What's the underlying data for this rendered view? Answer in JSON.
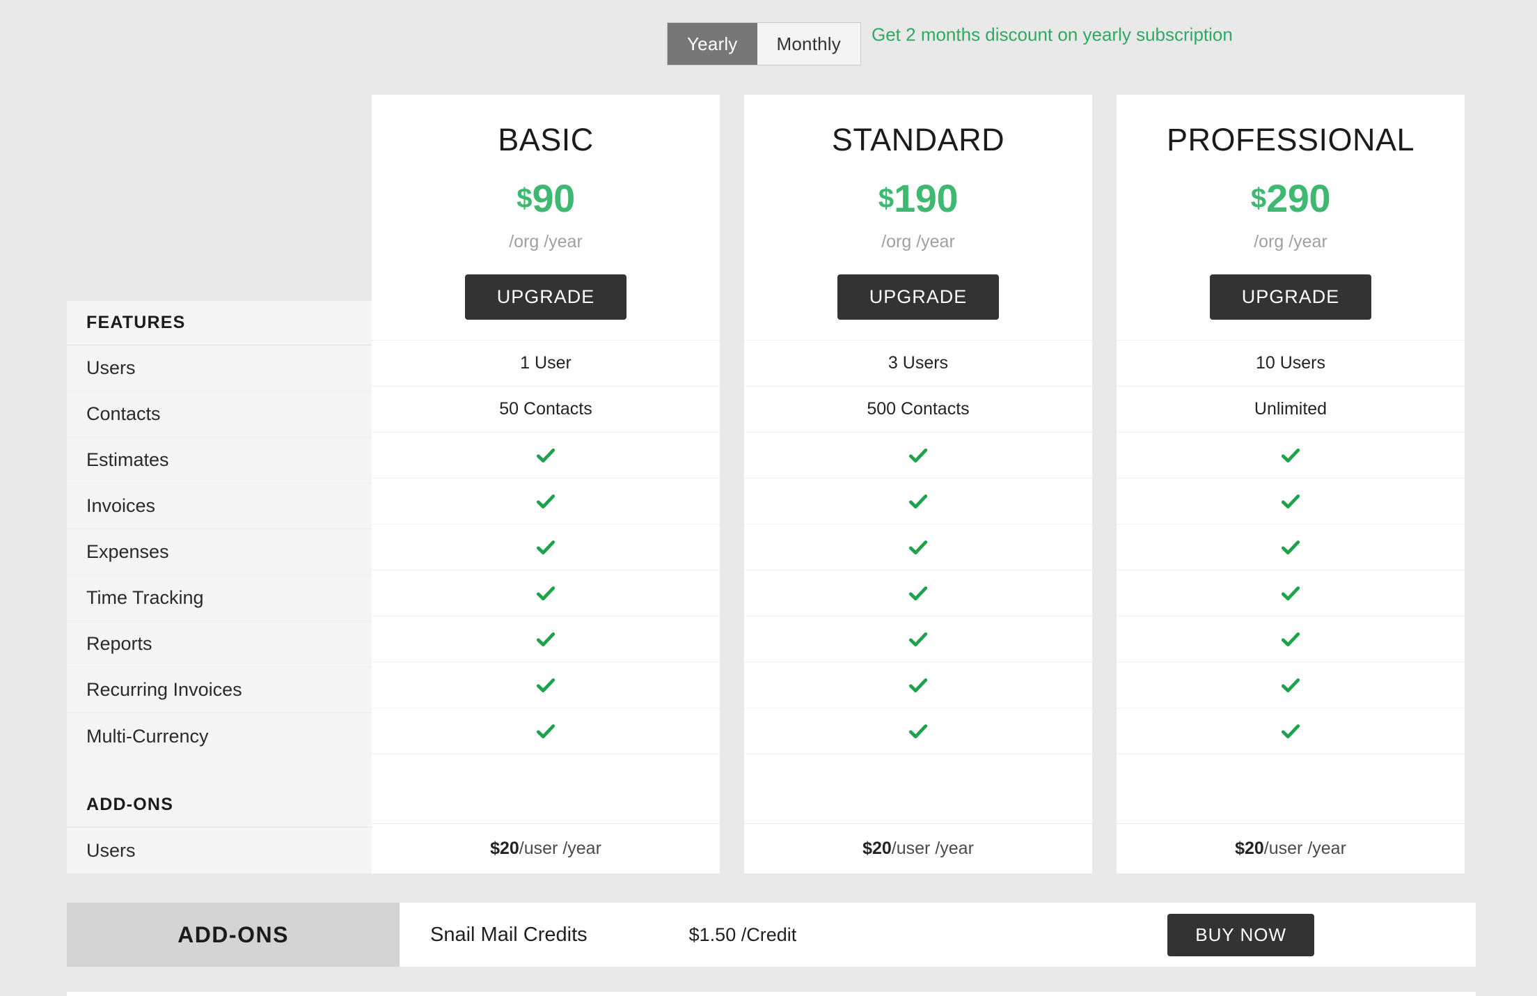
{
  "billing_toggle": {
    "options": [
      "Yearly",
      "Monthly"
    ],
    "selected": "Yearly",
    "discount_note": "Get 2 months discount on yearly subscription"
  },
  "features_panel": {
    "features_heading": "FEATURES",
    "features": [
      "Users",
      "Contacts",
      "Estimates",
      "Invoices",
      "Expenses",
      "Time Tracking",
      "Reports",
      "Recurring Invoices",
      "Multi-Currency"
    ],
    "addons_heading": "ADD-ONS",
    "addon_rows": [
      "Users"
    ]
  },
  "plans": [
    {
      "name": "BASIC",
      "currency": "$",
      "amount": "90",
      "period": "/org /year",
      "cta": "UPGRADE",
      "users": "1 User",
      "contacts": "50 Contacts",
      "estimates": "check",
      "invoices": "check",
      "expenses": "check",
      "time_tracking": "check",
      "reports": "check",
      "recurring_invoices": "check",
      "multi_currency": "check",
      "addon_user_price": "$20",
      "addon_user_unit": " /user /year"
    },
    {
      "name": "STANDARD",
      "currency": "$",
      "amount": "190",
      "period": "/org /year",
      "cta": "UPGRADE",
      "users": "3 Users",
      "contacts": "500 Contacts",
      "estimates": "check",
      "invoices": "check",
      "expenses": "check",
      "time_tracking": "check",
      "reports": "check",
      "recurring_invoices": "check",
      "multi_currency": "check",
      "addon_user_price": "$20",
      "addon_user_unit": " /user /year"
    },
    {
      "name": "PROFESSIONAL",
      "currency": "$",
      "amount": "290",
      "period": "/org /year",
      "cta": "UPGRADE",
      "users": "10 Users",
      "contacts": "Unlimited",
      "estimates": "check",
      "invoices": "check",
      "expenses": "check",
      "time_tracking": "check",
      "reports": "check",
      "recurring_invoices": "check",
      "multi_currency": "check",
      "addon_user_price": "$20",
      "addon_user_unit": " /user /year"
    }
  ],
  "addons_bar": {
    "label": "ADD-ONS",
    "item_name": "Snail Mail Credits",
    "item_rate": "$1.50 /Credit",
    "cta": "BUY NOW"
  },
  "colors": {
    "accent_green": "#3fb871",
    "check_green": "#1fa24c",
    "button_dark": "#333333",
    "page_bg": "#e9e9e9",
    "panel_bg": "#f5f5f5",
    "toggle_active_bg": "#777777",
    "addons_label_bg": "#d4d4d4"
  },
  "icons": {
    "check": "check-icon"
  }
}
